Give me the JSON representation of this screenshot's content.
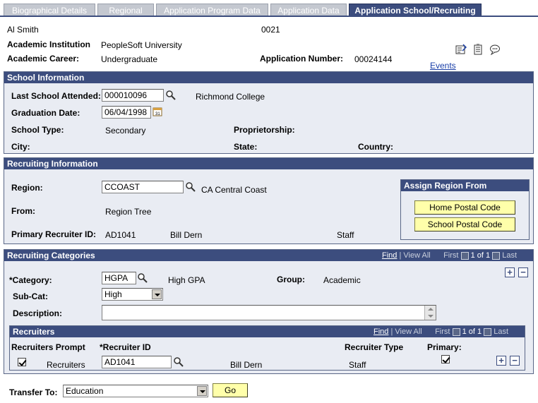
{
  "tabs": [
    {
      "label": "Biographical Details",
      "active": false
    },
    {
      "label": "Regional",
      "active": false
    },
    {
      "label": "Application Program Data",
      "active": false
    },
    {
      "label": "Application Data",
      "active": false
    },
    {
      "label": "Application School/Recruiting",
      "active": true
    }
  ],
  "header": {
    "name": "Al Smith",
    "id": "0021",
    "institution_label": "Academic Institution",
    "institution_value": "PeopleSoft University",
    "career_label": "Academic Career:",
    "career_value": "Undergraduate",
    "app_number_label": "Application Number:",
    "app_number_value": "00024144",
    "events_link": "Events"
  },
  "school_info": {
    "title": "School Information",
    "last_school_label": "Last School Attended:",
    "last_school_value": "000010096",
    "last_school_name": "Richmond College",
    "grad_date_label": "Graduation Date:",
    "grad_date_value": "06/04/1998",
    "school_type_label": "School Type:",
    "school_type_value": "Secondary",
    "proprietorship_label": "Proprietorship:",
    "city_label": "City:",
    "state_label": "State:",
    "country_label": "Country:"
  },
  "recruiting_info": {
    "title": "Recruiting Information",
    "region_label": "Region:",
    "region_value": "CCOAST",
    "region_desc": "CA Central Coast",
    "from_label": "From:",
    "from_value": "Region Tree",
    "primary_recruiter_label": "Primary Recruiter ID:",
    "primary_recruiter_id": "AD1041",
    "primary_recruiter_name": "Bill Dern",
    "primary_recruiter_type": "Staff",
    "assign_title": "Assign Region From",
    "home_postal_button": "Home Postal Code",
    "school_postal_button": "School Postal Code"
  },
  "recruiting_categories": {
    "title": "Recruiting Categories",
    "nav": {
      "find": "Find",
      "view_all": "View All",
      "first": "First",
      "count": "1 of 1",
      "last": "Last"
    },
    "category_label": "*Category:",
    "category_value": "HGPA",
    "category_desc": "High GPA",
    "group_label": "Group:",
    "group_value": "Academic",
    "subcat_label": "Sub-Cat:",
    "subcat_value": "High",
    "description_label": "Description:",
    "description_value": "",
    "recruiters": {
      "title": "Recruiters",
      "nav": {
        "find": "Find",
        "view_all": "View All",
        "first": "First",
        "count": "1 of 1",
        "last": "Last"
      },
      "col_prompt": "Recruiters Prompt",
      "col_id": "*Recruiter ID",
      "col_type": "Recruiter Type",
      "col_primary": "Primary:",
      "row": {
        "prompt_label": "Recruiters",
        "recruiter_id": "AD1041",
        "name": "Bill Dern",
        "type": "Staff"
      }
    }
  },
  "footer": {
    "transfer_label": "Transfer To:",
    "transfer_value": "Education",
    "go_button": "Go"
  },
  "colors": {
    "header_bar": "#3c4d7e",
    "group_background": "#e9ecf3",
    "button_yellow": "#ffffaa",
    "link_blue": "#1a3fa8"
  }
}
